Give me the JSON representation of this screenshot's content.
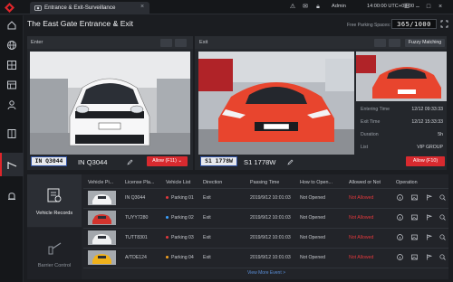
{
  "app": {
    "tab_label": "Entrance & Exit-Surveillance",
    "user": "Admin",
    "clock": "14:00:00 UTC+08:00"
  },
  "header": {
    "title": "The East Gate Entrance & Exit",
    "free_spaces_label": "Free Parking Spaces:",
    "free_spaces_value": "365/1000"
  },
  "enter": {
    "label": "Enter",
    "plate_badge": "IN Q3044",
    "plate_text": "IN Q3044",
    "allow_button": "Allow (F11)"
  },
  "exit": {
    "label": "Exit",
    "fuzzy_button": "Fuzzy Matching",
    "plate_badge": "S1 1778W",
    "plate_text": "S1 1778W",
    "allow_button": "Allow (F10)",
    "info": [
      {
        "key": "Entering Time",
        "value": "12/12 09:33:33"
      },
      {
        "key": "Exit Time",
        "value": "12/12 15:33:33"
      },
      {
        "key": "Duration",
        "value": "5h"
      },
      {
        "key": "List",
        "value": "VIP GROUP"
      }
    ]
  },
  "bottom": {
    "tabs": [
      {
        "label": "Vehicle Records"
      },
      {
        "label": "Barrier Control"
      }
    ],
    "columns": [
      "Vehicle Pi...",
      "License Pla...",
      "Vehicle List",
      "Direction",
      "Passing Time",
      "How to Open...",
      "Allowed or Not",
      "Operation"
    ],
    "rows": [
      {
        "plate": "IN Q3044",
        "list": "Parking 01",
        "direction": "Exit",
        "time": "2019/9/12 10:01:03",
        "open": "Not Opened",
        "allowed": "Not Allowed"
      },
      {
        "plate": "TUYY7280",
        "list": "Parking 02",
        "direction": "Exit",
        "time": "2019/9/12 10:01:03",
        "open": "Not Opened",
        "allowed": "Not Allowed"
      },
      {
        "plate": "TUTT8301",
        "list": "Parking 03",
        "direction": "Exit",
        "time": "2019/9/12 10:01:03",
        "open": "Not Opened",
        "allowed": "Not Allowed"
      },
      {
        "plate": "A/TDE124",
        "list": "Parking 04",
        "direction": "Exit",
        "time": "2019/9/12 10:01:03",
        "open": "Not Opened",
        "allowed": "Not Allowed"
      }
    ],
    "view_more": "View More Event >"
  },
  "colors": {
    "accent": "#e0262b",
    "dot_colors": [
      "#e0383c",
      "#3aa0ff",
      "#e0383c",
      "#f0a020"
    ]
  },
  "icons": {
    "rail": [
      "home-icon",
      "globe-icon",
      "grid-icon",
      "layout-icon",
      "person-icon",
      "book-icon",
      "barrier-icon",
      "alarm-icon"
    ]
  }
}
